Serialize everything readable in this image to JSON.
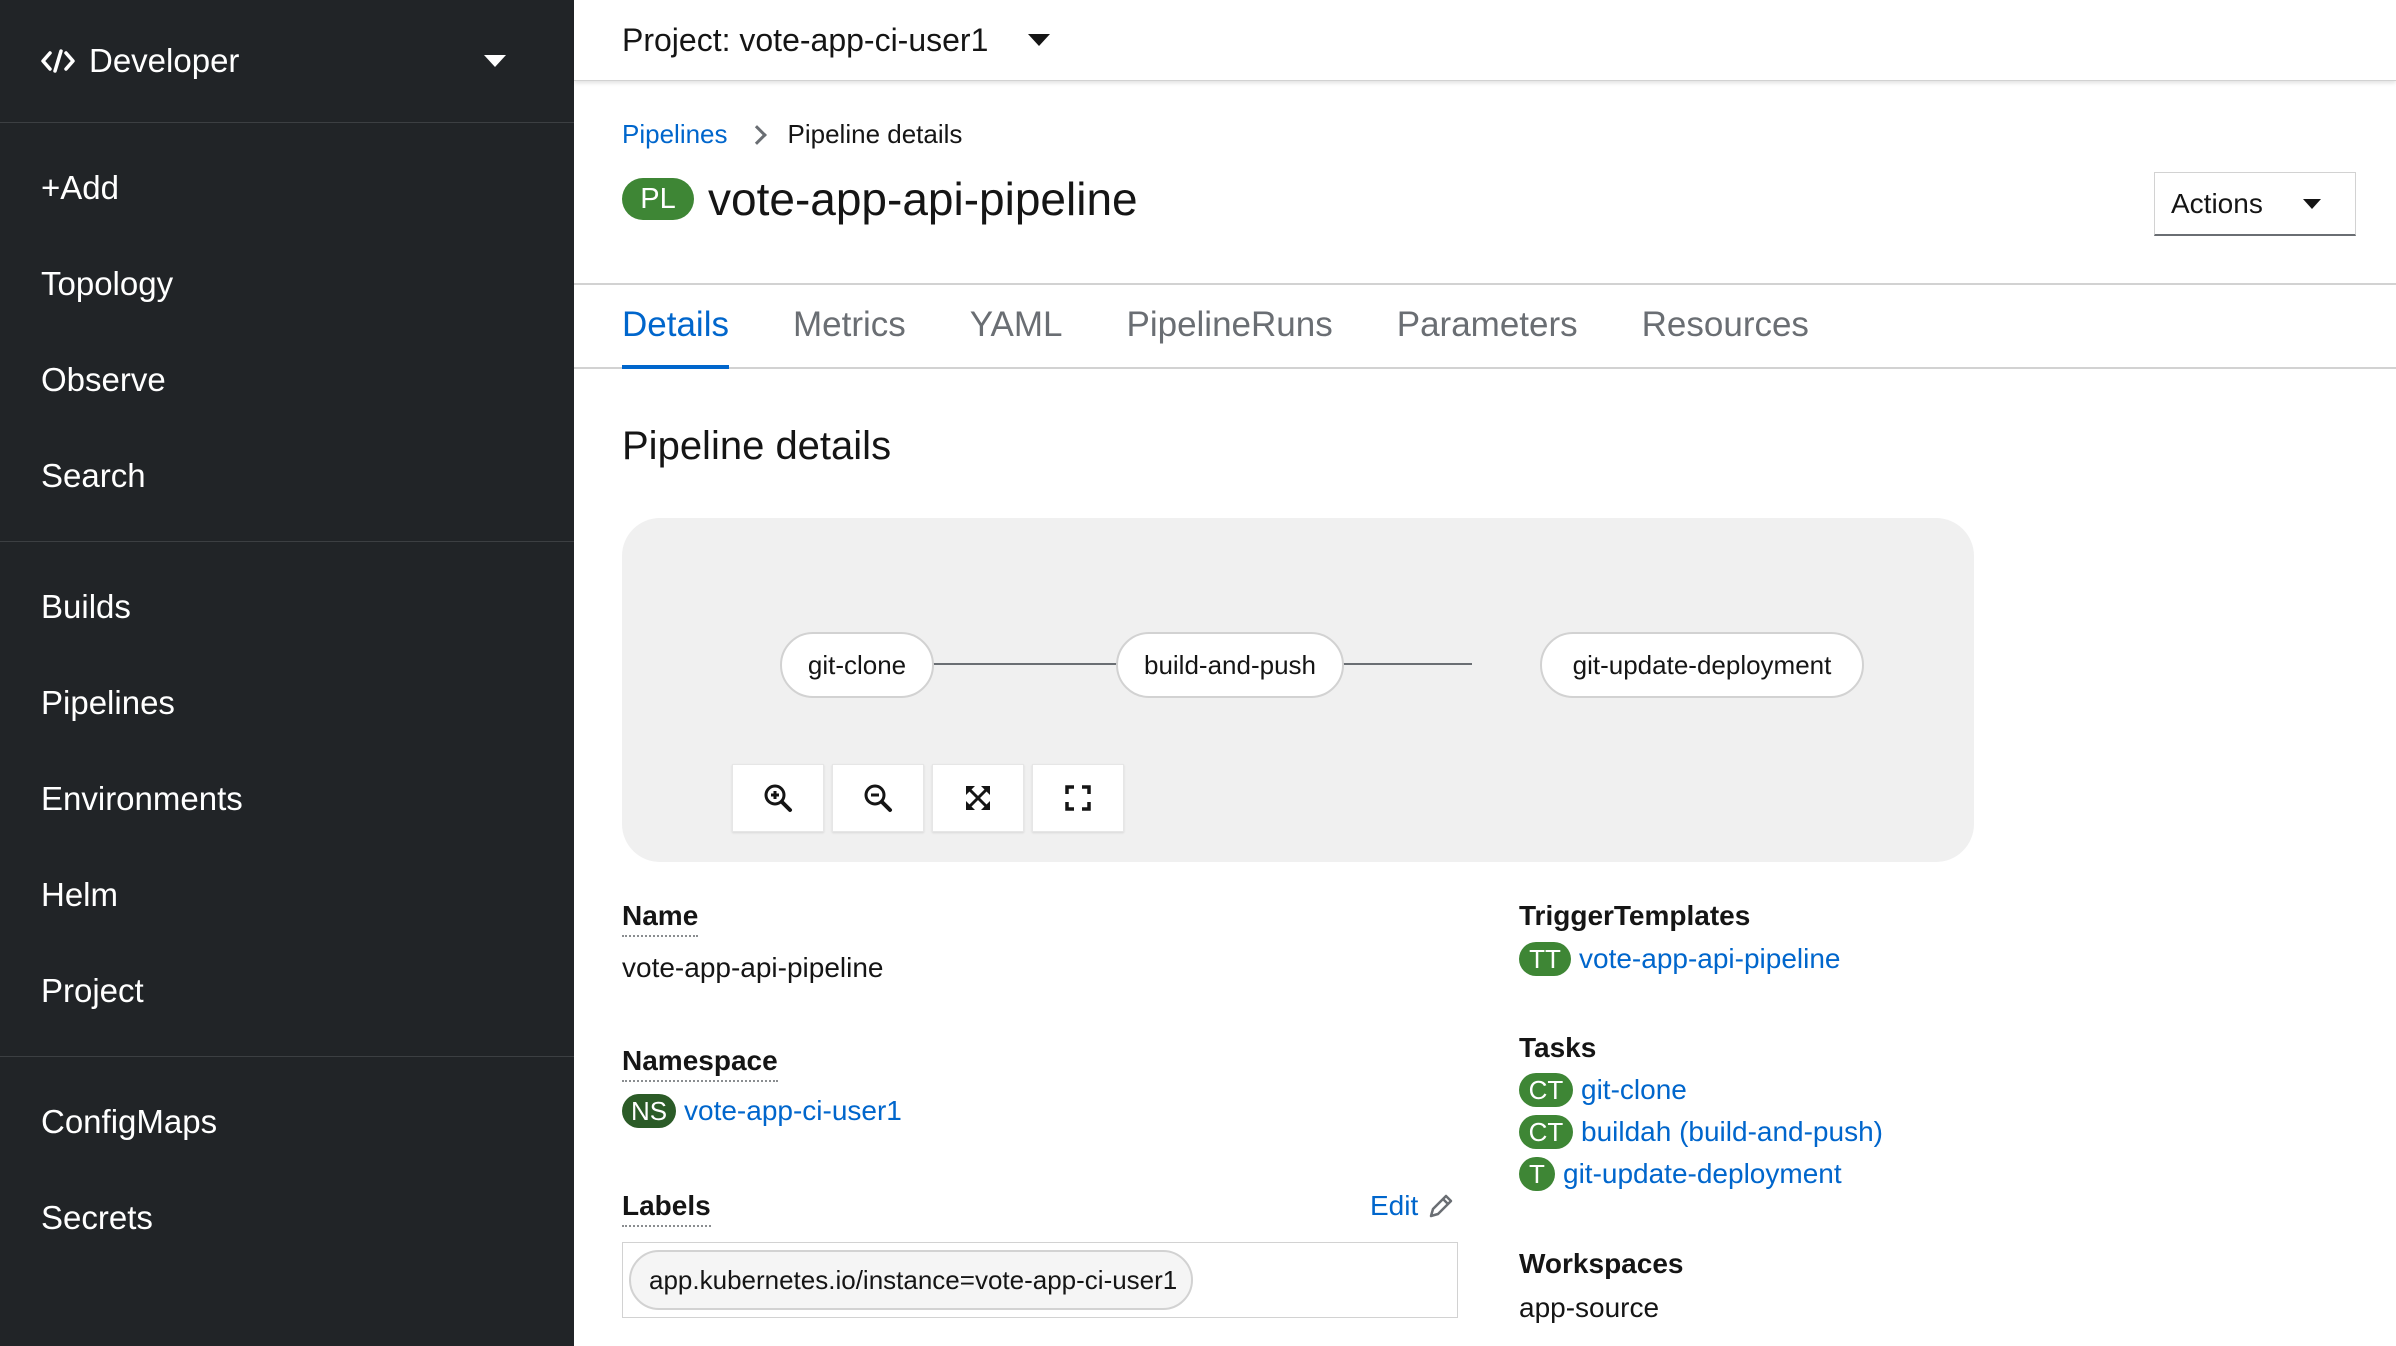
{
  "perspective": {
    "label": "Developer",
    "icon": "code-icon"
  },
  "nav": {
    "group1": [
      "+Add",
      "Topology",
      "Observe",
      "Search"
    ],
    "group2": [
      "Builds",
      "Pipelines",
      "Environments",
      "Helm",
      "Project"
    ],
    "group3": [
      "ConfigMaps",
      "Secrets"
    ]
  },
  "project_bar": {
    "label": "Project: vote-app-ci-user1"
  },
  "breadcrumb": {
    "parent": "Pipelines",
    "current": "Pipeline details"
  },
  "page": {
    "badge": "PL",
    "title": "vote-app-api-pipeline",
    "actions_label": "Actions"
  },
  "tabs": [
    "Details",
    "Metrics",
    "YAML",
    "PipelineRuns",
    "Parameters",
    "Resources"
  ],
  "section_title": "Pipeline details",
  "topology": {
    "nodes": [
      "git-clone",
      "build-and-push",
      "git-update-deployment"
    ],
    "controls": [
      "zoom-in-icon",
      "zoom-out-icon",
      "fit-to-screen-icon",
      "expand-icon"
    ]
  },
  "details": {
    "name_label": "Name",
    "name_value": "vote-app-api-pipeline",
    "namespace_label": "Namespace",
    "namespace_badge": "NS",
    "namespace_value": "vote-app-ci-user1",
    "labels_label": "Labels",
    "labels_edit": "Edit",
    "label_chip": "app.kubernetes.io/instance=vote-app-ci-user1"
  },
  "right_details": {
    "trigger_label": "TriggerTemplates",
    "trigger_badge": "TT",
    "trigger_value": "vote-app-api-pipeline",
    "tasks_label": "Tasks",
    "tasks": [
      {
        "badge": "CT",
        "name": "git-clone"
      },
      {
        "badge": "CT",
        "name": "buildah (build-and-push)"
      },
      {
        "badge": "T",
        "name": "git-update-deployment"
      }
    ],
    "workspaces_label": "Workspaces",
    "workspaces_value": "app-source"
  },
  "colors": {
    "sidebar_bg": "#212427",
    "link": "#0066cc",
    "badge_green": "#3e8635",
    "topology_bg": "#f0f0f0"
  }
}
